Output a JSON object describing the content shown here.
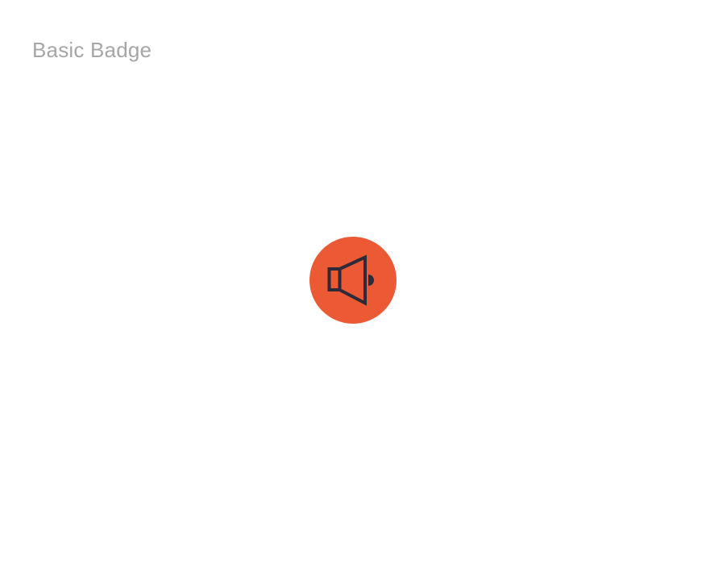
{
  "header": {
    "title": "Basic Badge"
  },
  "badge": {
    "icon": "speaker-icon",
    "background_color": "#EB5A34",
    "icon_color": "#2D2B3A"
  }
}
